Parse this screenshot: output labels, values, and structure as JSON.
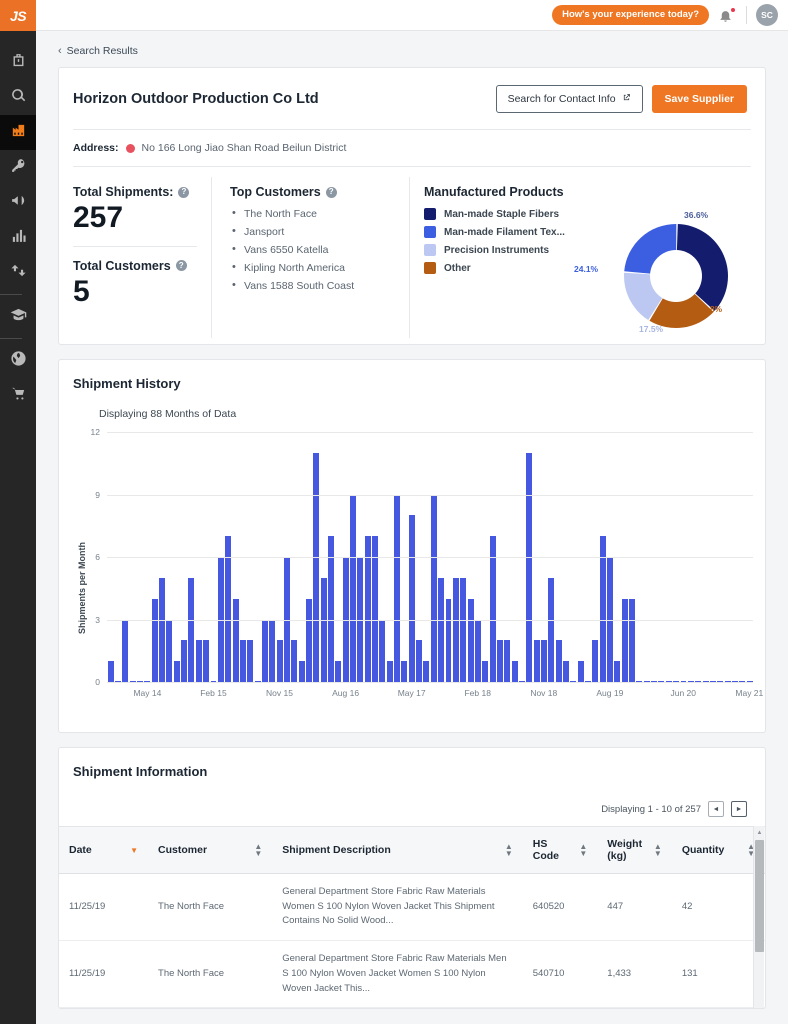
{
  "brand": {
    "logo_text": "JS",
    "accent": "#ef7622",
    "sidebar_bg": "#262626"
  },
  "sidebar": {
    "items": [
      {
        "icon": "briefcase-icon",
        "active": false
      },
      {
        "icon": "search-icon",
        "active": false
      },
      {
        "icon": "factory-icon",
        "active": true
      },
      {
        "icon": "key-icon",
        "active": false
      },
      {
        "icon": "megaphone-icon",
        "active": false
      },
      {
        "icon": "bar-chart-icon",
        "active": false
      },
      {
        "icon": "exchange-icon",
        "active": false
      },
      {
        "icon": "graduation-cap-icon",
        "active": false
      },
      {
        "icon": "globe-icon",
        "active": false
      },
      {
        "icon": "shopping-cart-icon",
        "active": false
      }
    ]
  },
  "topbar": {
    "feedback_label": "How's your experience today?",
    "bell_icon": "bell-icon",
    "has_notification": true,
    "avatar_initials": "SC"
  },
  "breadcrumb": {
    "back_label": "Search Results"
  },
  "supplier": {
    "name": "Horizon Outdoor Production Co Ltd",
    "search_contact_label": "Search for Contact Info",
    "save_supplier_label": "Save Supplier",
    "address_label": "Address:",
    "address_value": "No 166 Long Jiao Shan Road Beilun District"
  },
  "stats": {
    "total_shipments_label": "Total Shipments:",
    "total_shipments_value": "257",
    "total_customers_label": "Total Customers",
    "total_customers_value": "5",
    "top_customers_label": "Top Customers",
    "top_customers": [
      "The North Face",
      "Jansport",
      "Vans 6550 Katella",
      "Kipling North America",
      "Vans 1588 South Coast"
    ]
  },
  "products": {
    "title": "Manufactured Products",
    "legend": [
      {
        "label": "Man-made Staple Fibers",
        "color": "#141c6e"
      },
      {
        "label": "Man-made Filament Tex...",
        "color": "#3b5fe0"
      },
      {
        "label": "Precision Instruments",
        "color": "#bcc8f2"
      },
      {
        "label": "Other",
        "color": "#b35c12"
      }
    ]
  },
  "shipment_history": {
    "title": "Shipment History",
    "subtitle": "Displaying 88 Months of Data"
  },
  "shipment_info": {
    "title": "Shipment Information",
    "pagination_text": "Displaying 1 - 10 of 257",
    "prev_label": "◄",
    "next_label": "►",
    "columns": [
      {
        "label": "Date",
        "sort": "desc"
      },
      {
        "label": "Customer",
        "sort": "none"
      },
      {
        "label": "Shipment Description",
        "sort": "none"
      },
      {
        "label": "HS Code",
        "sort": "none"
      },
      {
        "label": "Weight (kg)",
        "sort": "none"
      },
      {
        "label": "Quantity",
        "sort": "none"
      }
    ],
    "rows": [
      {
        "date": "11/25/19",
        "customer": "The North Face",
        "description": "General Department Store Fabric Raw Materials Women S 100 Nylon Woven Jacket This Shipment Contains No Solid Wood...",
        "hs_code": "640520",
        "weight": "447",
        "quantity": "42"
      },
      {
        "date": "11/25/19",
        "customer": "The North Face",
        "description": "General Department Store Fabric Raw Materials Men S 100 Nylon Woven Jacket Women S 100 Nylon Woven Jacket This...",
        "hs_code": "540710",
        "weight": "1,433",
        "quantity": "131"
      }
    ]
  },
  "chart_data": [
    {
      "type": "pie",
      "title": "Manufactured Products",
      "labels": [
        "Man-made Staple Fibers",
        "Man-made Filament Tex...",
        "Man-made Filament Tex... pct",
        "Precision Instruments",
        "Other"
      ],
      "slices": [
        {
          "name": "Man-made Staple Fibers",
          "value": 36.6,
          "label": "36.6%",
          "color": "#141c6e"
        },
        {
          "name": "Other",
          "value": 21.8,
          "label": "21.8%",
          "color": "#b35c12"
        },
        {
          "name": "Precision Instruments",
          "value": 17.5,
          "label": "17.5%",
          "color": "#bcc8f2"
        },
        {
          "name": "Man-made Filament Tex...",
          "value": 24.1,
          "label": "24.1%",
          "color": "#3b5fe0"
        }
      ],
      "donut": true,
      "legend_position": "left"
    },
    {
      "type": "bar",
      "title": "Shipment History",
      "subtitle": "Displaying 88 Months of Data",
      "xlabel": "",
      "ylabel": "Shipments per Month",
      "ylim": [
        0,
        12
      ],
      "yticks": [
        0,
        3,
        6,
        9,
        12
      ],
      "grid": true,
      "bar_color": "#4758e0",
      "xtick_labels": [
        "May 14",
        "Feb 15",
        "Nov 15",
        "Aug 16",
        "May 17",
        "Feb 18",
        "Nov 18",
        "Aug 19",
        "Jun 20",
        "May 21"
      ],
      "xtick_indices": [
        5,
        14,
        23,
        32,
        41,
        50,
        59,
        68,
        78,
        87
      ],
      "categories": [
        "Dec 13",
        "Jan 14",
        "Feb 14",
        "Mar 14",
        "Apr 14",
        "May 14",
        "Jun 14",
        "Jul 14",
        "Aug 14",
        "Sep 14",
        "Oct 14",
        "Nov 14",
        "Dec 14",
        "Jan 15",
        "Feb 15",
        "Mar 15",
        "Apr 15",
        "May 15",
        "Jun 15",
        "Jul 15",
        "Aug 15",
        "Sep 15",
        "Oct 15",
        "Nov 15",
        "Dec 15",
        "Jan 16",
        "Feb 16",
        "Mar 16",
        "Apr 16",
        "May 16",
        "Jun 16",
        "Jul 16",
        "Aug 16",
        "Sep 16",
        "Oct 16",
        "Nov 16",
        "Dec 16",
        "Jan 17",
        "Feb 17",
        "Mar 17",
        "Apr 17",
        "May 17",
        "Jun 17",
        "Jul 17",
        "Aug 17",
        "Sep 17",
        "Oct 17",
        "Nov 17",
        "Dec 17",
        "Jan 18",
        "Feb 18",
        "Mar 18",
        "Apr 18",
        "May 18",
        "Jun 18",
        "Jul 18",
        "Aug 18",
        "Sep 18",
        "Oct 18",
        "Nov 18",
        "Dec 18",
        "Jan 19",
        "Feb 19",
        "Mar 19",
        "Apr 19",
        "May 19",
        "Jun 19",
        "Jul 19",
        "Aug 19",
        "Sep 19",
        "Oct 19",
        "Nov 19",
        "Dec 19",
        "Jan 20",
        "Feb 20",
        "Mar 20",
        "Apr 20",
        "May 20",
        "Jun 20",
        "Jul 20",
        "Aug 20",
        "Sep 20",
        "Oct 20",
        "Nov 20",
        "Dec 20",
        "Jan 21",
        "Feb 21",
        "Mar 21"
      ],
      "values": [
        1,
        0,
        3,
        0,
        0,
        0,
        4,
        5,
        3,
        1,
        2,
        5,
        2,
        2,
        0,
        6,
        7,
        4,
        2,
        2,
        0,
        3,
        3,
        2,
        6,
        2,
        1,
        4,
        11,
        5,
        7,
        1,
        6,
        9,
        6,
        7,
        7,
        3,
        1,
        9,
        1,
        8,
        2,
        1,
        9,
        5,
        4,
        5,
        5,
        4,
        3,
        1,
        7,
        2,
        2,
        1,
        0,
        11,
        2,
        2,
        5,
        2,
        1,
        0,
        1,
        0,
        2,
        7,
        6,
        1,
        4,
        4,
        0,
        0,
        0,
        0,
        0,
        0,
        0,
        0,
        0,
        0,
        0,
        0,
        0,
        0,
        0,
        0
      ]
    }
  ]
}
